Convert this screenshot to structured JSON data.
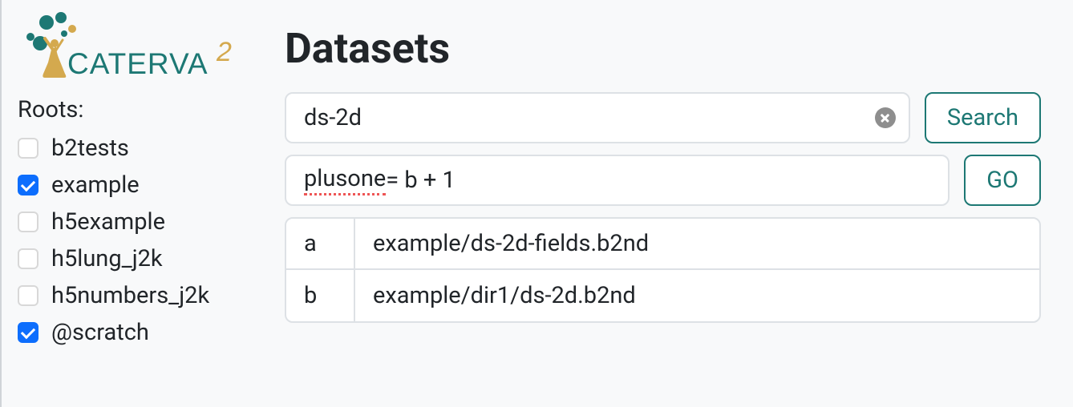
{
  "brand": {
    "name": "CATERVA",
    "suffix": "2"
  },
  "sidebar": {
    "roots_label": "Roots:",
    "items": [
      {
        "label": "b2tests",
        "checked": false
      },
      {
        "label": "example",
        "checked": true
      },
      {
        "label": "h5example",
        "checked": false
      },
      {
        "label": "h5lung_j2k",
        "checked": false
      },
      {
        "label": "h5numbers_j2k",
        "checked": false
      },
      {
        "label": "@scratch",
        "checked": true
      }
    ]
  },
  "main": {
    "title": "Datasets",
    "search": {
      "value": "ds-2d",
      "button_label": "Search"
    },
    "expression": {
      "lhs": "plusone",
      "rhs": " = b + 1",
      "go_label": "GO"
    },
    "mappings": [
      {
        "key": "a",
        "value": "example/ds-2d-fields.b2nd"
      },
      {
        "key": "b",
        "value": "example/dir1/ds-2d.b2nd"
      }
    ]
  }
}
